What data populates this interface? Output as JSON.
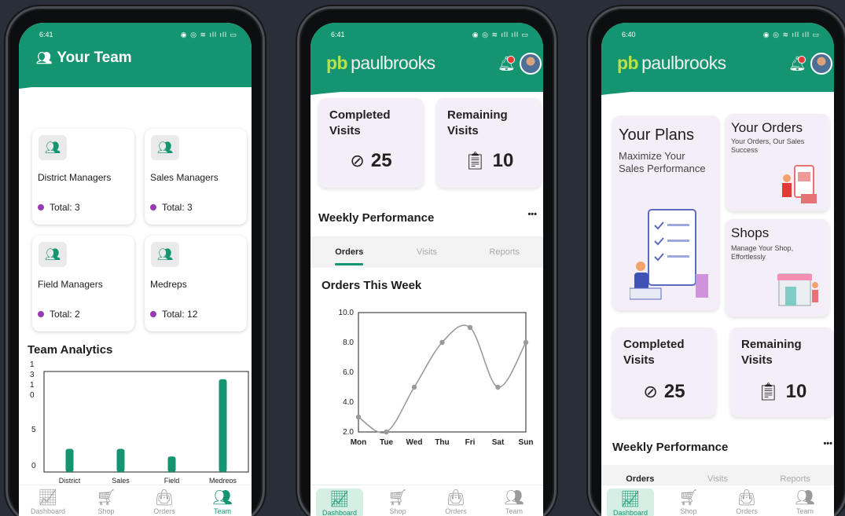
{
  "status_bar": {
    "p1_time": "6:41",
    "p2_time": "6:41",
    "p3_time": "6:40"
  },
  "brand": {
    "mark": "pb",
    "name": "paulbrooks",
    "primary": "#149470",
    "accent": "#b7e24a"
  },
  "team_screen": {
    "title": "Your Team",
    "title_icon": "team-icon",
    "managers": [
      {
        "name": "District Managers",
        "total": "Total: 3"
      },
      {
        "name": "Sales Managers",
        "total": "Total: 3"
      },
      {
        "name": "Field Managers",
        "total": "Total: 2"
      },
      {
        "name": "Medreps",
        "total": "Total: 12"
      }
    ],
    "analytics_title": "Team Analytics"
  },
  "team_chart": {
    "chart_data": {
      "type": "bar",
      "categories": [
        "District",
        "Sales",
        "Field",
        "Medreps"
      ],
      "values": [
        3,
        3,
        2,
        12
      ],
      "title": "",
      "xlabel": "",
      "ylabel": "",
      "y_ticks": [
        "1\n3\n1\n0",
        "5",
        "0"
      ],
      "ylim": [
        0,
        13
      ],
      "color": "#149470"
    }
  },
  "visits": {
    "completed_label": "Completed Visits",
    "completed_value": "25",
    "remaining_label": "Remaining Visits",
    "remaining_value": "10"
  },
  "performance": {
    "title": "Weekly Performance",
    "more": "•••",
    "tabs": [
      "Orders",
      "Visits",
      "Reports"
    ],
    "chart_title": "Orders This Week"
  },
  "chart_data": {
    "type": "line",
    "title": "Orders This Week",
    "x": [
      "Mon",
      "Tue",
      "Wed",
      "Thu",
      "Fri",
      "Sat",
      "Sun"
    ],
    "series": [
      {
        "values": [
          3,
          2,
          5,
          8,
          9,
          5,
          8
        ]
      }
    ],
    "ylim": [
      2,
      10
    ],
    "y_ticks": [
      "2.0",
      "4.0",
      "6.0",
      "8.0",
      "10.0"
    ],
    "grid": false,
    "color": "#9a9a9a"
  },
  "plans": {
    "your_plans_title": "Your Plans",
    "your_plans_sub_1": "Maximize Your",
    "your_plans_sub_2": "Sales Performance",
    "your_orders_title": "Your Orders",
    "your_orders_sub": "Your Orders, Our Sales Success",
    "shops_title": "Shops",
    "shops_sub": "Manage Your Shop, Effortlessly"
  },
  "nav": {
    "items": [
      {
        "label": "Dashboard",
        "icon": "chart-icon"
      },
      {
        "label": "Shop",
        "icon": "cart-icon"
      },
      {
        "label": "Orders",
        "icon": "bag-icon"
      },
      {
        "label": "Team",
        "icon": "team-icon"
      }
    ]
  }
}
